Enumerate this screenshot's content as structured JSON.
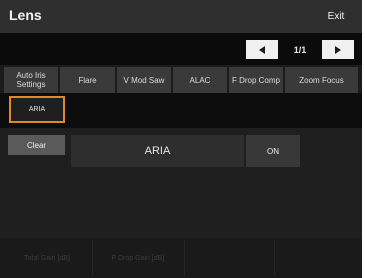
{
  "header": {
    "title": "Lens",
    "exit_label": "Exit"
  },
  "nav": {
    "page_indicator": "1/1",
    "prev_icon": "triangle-left",
    "next_icon": "triangle-right"
  },
  "tabs": [
    {
      "label": "Auto Iris Settings"
    },
    {
      "label": "Flare"
    },
    {
      "label": "V Mod Saw"
    },
    {
      "label": "ALAC"
    },
    {
      "label": "F Drop Comp"
    },
    {
      "label": "Zoom Focus"
    }
  ],
  "sub_buttons": {
    "aria_label": "ARIA"
  },
  "controls": {
    "clear_label": "Clear",
    "value_display": "ARIA",
    "state_label": "ON"
  },
  "footer": [
    {
      "label": "Total Gain [dB]"
    },
    {
      "label": "F Drop Gain [dB]"
    }
  ],
  "colors": {
    "accent": "#e0892a",
    "background": "#1b1b1b",
    "header": "#2f2f2f"
  }
}
